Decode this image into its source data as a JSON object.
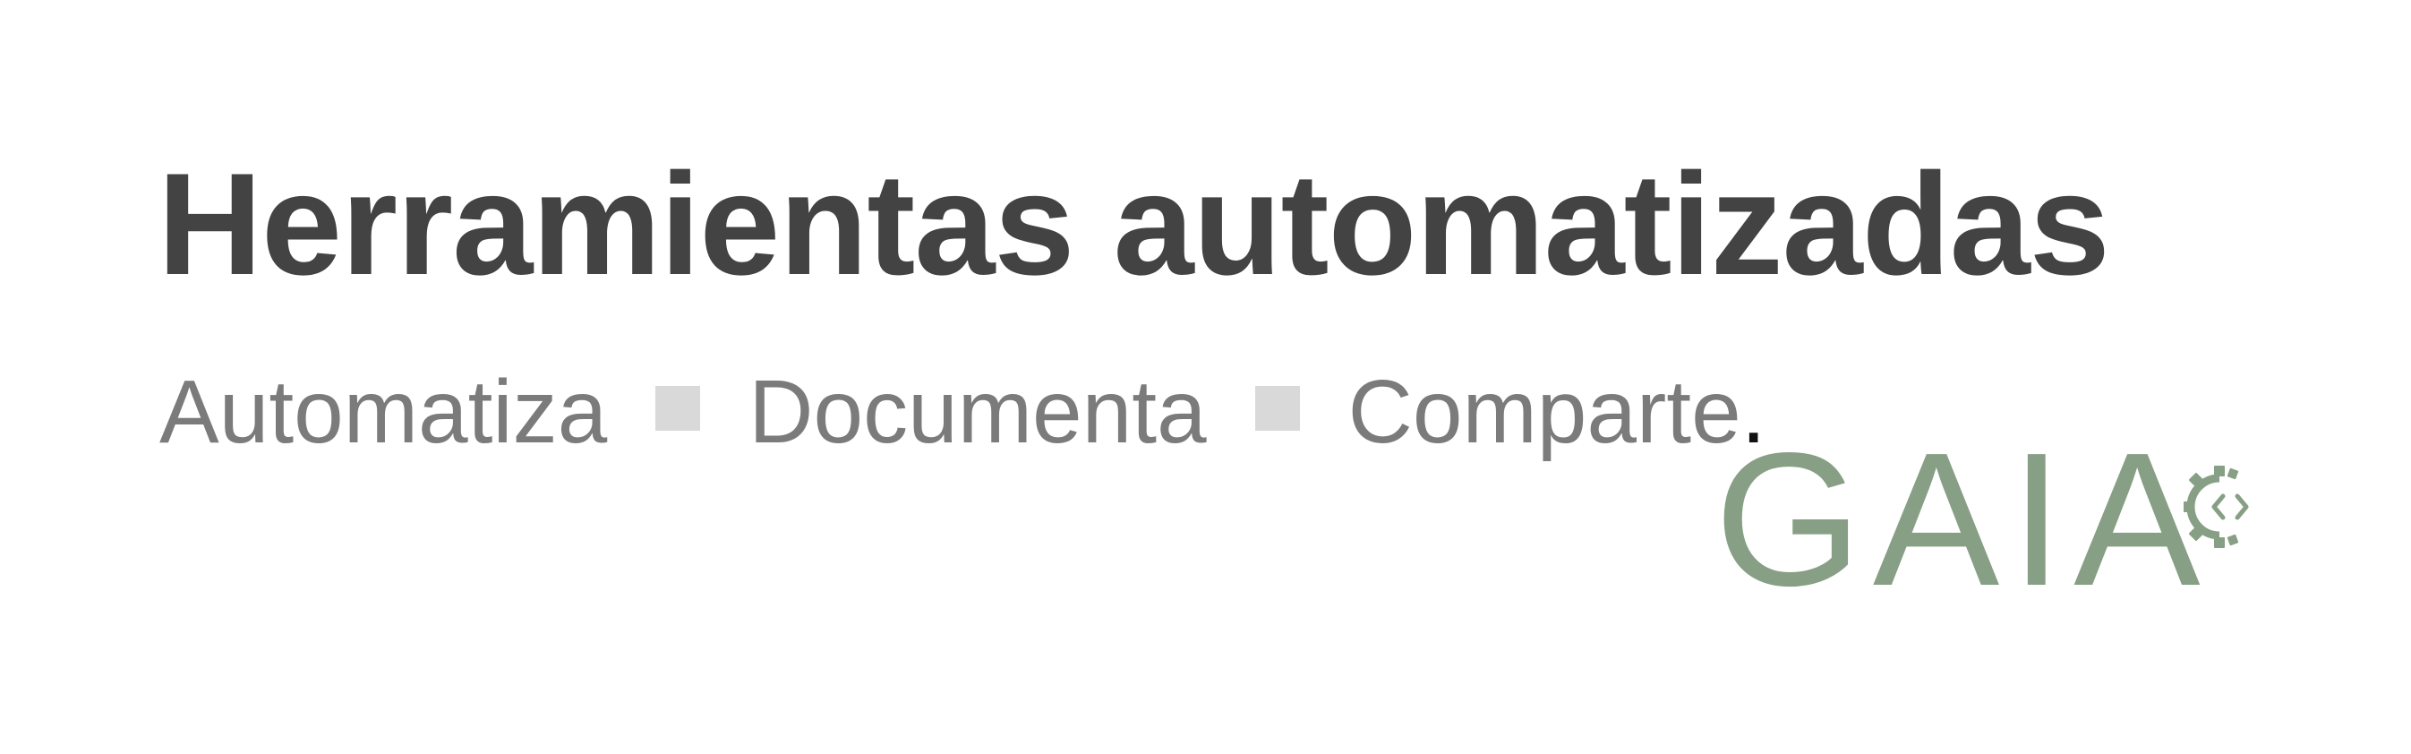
{
  "headline": "Herramientas automatizadas",
  "tagline": {
    "items": [
      "Automatiza",
      "Documenta",
      "Comparte"
    ],
    "terminator": "."
  },
  "logo": {
    "text": "GAIA",
    "icon": "gear-code-icon"
  },
  "colors": {
    "headline": "#434343",
    "tagline": "#7b7b7b",
    "separator": "#d9d9d9",
    "period": "#111111",
    "logo": "#879f84"
  }
}
